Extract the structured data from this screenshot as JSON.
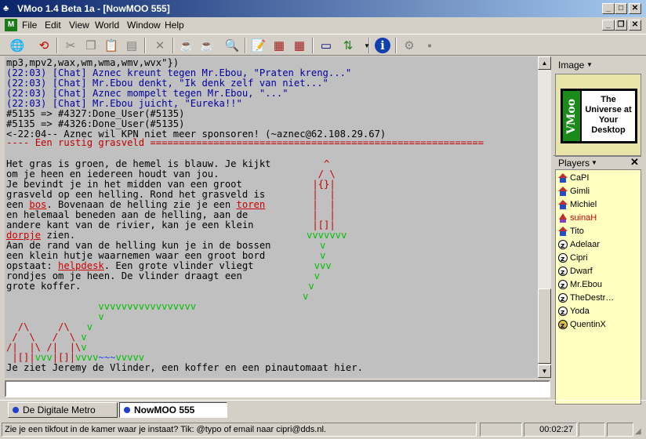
{
  "window": {
    "title": "VMoo 1.4 Beta 1a - [NowMOO 555]"
  },
  "menu": [
    "File",
    "Edit",
    "View",
    "World",
    "Window",
    "Help"
  ],
  "output": {
    "lines": [
      {
        "text": "mp3,mpv2,wax,wm,wma,wmv,wvx\"})",
        "cls": ""
      },
      {
        "text": "(22:03) [Chat] Aznec kreunt tegen Mr.Ebou, \"Praten kreng...\"",
        "cls": "blue"
      },
      {
        "text": "(22:03) [Chat] Mr.Ebou denkt, \"Ik denk zelf van niet...\"",
        "cls": "blue"
      },
      {
        "text": "(22:03) [Chat] Aznec mompelt tegen Mr.Ebou, \"...\"",
        "cls": "blue"
      },
      {
        "text": "(22:03) [Chat] Mr.Ebou juicht, \"Eureka!!\"",
        "cls": "blue"
      },
      {
        "text": "#5135 => #4327:Done_User(#5135)",
        "cls": ""
      },
      {
        "text": "#5135 => #4326:Done_User(#5135)",
        "cls": ""
      },
      {
        "text": "<-22:04-- Aznec wil KPN niet meer sponsoren! (~aznec@62.108.29.67)",
        "cls": ""
      }
    ],
    "room_title": "Een rustig grasveld",
    "desc": [
      "Het gras is groen, de hemel is blauw. Je kijkt",
      "om je heen en iedereen houdt van jou.",
      "Je bevindt je in het midden van een groot",
      "grasveld op een helling. Rond het grasveld is",
      "een ",
      "bos",
      ". Bovenaan de helling zie je een ",
      "toren",
      "en helemaal beneden aan de helling, aan de",
      "andere kant van de rivier, kan je een klein",
      "dorpje",
      " zien.",
      "Aan de rand van de helling kun je in de bossen",
      "een klein hutje waarnemen waar een groot bord",
      "opstaat: ",
      "helpdesk",
      ". Een grote vlinder vliegt",
      "rondjes om je heen. De vlinder draagt een",
      "grote koffer."
    ],
    "contents": "Je ziet Jeremy de Vlinder, een koffer en een pinautomaat hier."
  },
  "side": {
    "image_label": "Image",
    "logo_left": "VMoo",
    "logo_right": "The Universe at Your Desktop",
    "players_label": "Players",
    "players": [
      {
        "name": "CaPI",
        "icon": "house",
        "color": "#000000"
      },
      {
        "name": "Gimli",
        "icon": "house",
        "color": "#000000"
      },
      {
        "name": "Michiel",
        "icon": "house",
        "color": "#000000"
      },
      {
        "name": "suinaH",
        "icon": "wizard",
        "color": "#cc0000"
      },
      {
        "name": "Tito",
        "icon": "house",
        "color": "#000000"
      },
      {
        "name": "Adelaar",
        "icon": "sleep",
        "color": "#000000"
      },
      {
        "name": "Cipri",
        "icon": "sleep",
        "color": "#000000"
      },
      {
        "name": "Dwarf",
        "icon": "sleep",
        "color": "#000000"
      },
      {
        "name": "Mr.Ebou",
        "icon": "sleep",
        "color": "#000000"
      },
      {
        "name": "TheDestr…",
        "icon": "sleep",
        "color": "#000000"
      },
      {
        "name": "Yoda",
        "icon": "sleep",
        "color": "#000000"
      },
      {
        "name": "QuentinX",
        "icon": "sleep-coin",
        "color": "#000000"
      }
    ]
  },
  "taskbar": {
    "tabs": [
      "De Digitale Metro",
      "NowMOO 555"
    ]
  },
  "status": {
    "message": "Zie je een tikfout in de kamer waar je instaat? Tik: @typo of email naar cipri@dds.nl.",
    "time": "00:02:27"
  },
  "colors": {
    "chat": "#0000a0",
    "link": "#cc0000",
    "grass": "#00c000",
    "title_bar": "#0a246a",
    "players_bg": "#ffffc0"
  }
}
